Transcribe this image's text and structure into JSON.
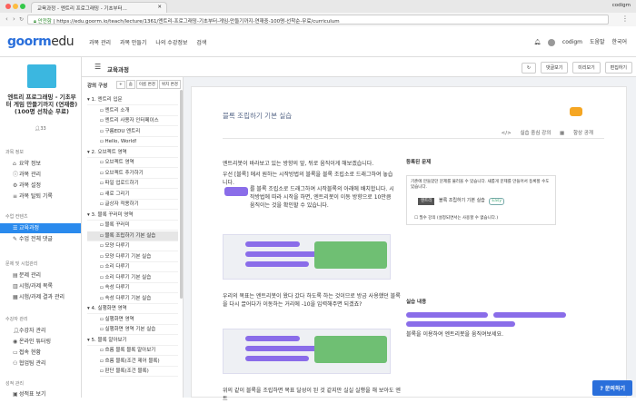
{
  "browser": {
    "tab_title": "교육과정 - 엔트리 프로그래밍 - 기초부터...",
    "profile": "codigm",
    "secure_label": "안전함",
    "url": "https://edu.goorm.io/teach/lecture/1361/엔트리-프로그래밍-기초부터-게임-만들기까지-연재중-100명-선착순-무료/curriculum"
  },
  "header": {
    "logo_main": "goorm",
    "logo_sub": "edu",
    "menu": [
      "과목 관리",
      "과목 만들기",
      "나의 수강정보",
      "검색"
    ],
    "user_name": "codigm",
    "help_label": "도움말",
    "language": "한국어"
  },
  "sidebar": {
    "course_title": "엔트리 프로그래밍 - 기초부터 게임 만들기까지 (연재중)(100명 선착순 무료)",
    "likes": "33",
    "sections": [
      {
        "label": "과목 정보",
        "items": [
          {
            "label": "요약 정보",
            "icon": "home-icon"
          },
          {
            "label": "과목 관리",
            "icon": "info-icon"
          },
          {
            "label": "과목 설정",
            "icon": "gear-icon"
          },
          {
            "label": "과목 탈퇴 기록",
            "icon": "list-icon"
          }
        ]
      },
      {
        "label": "수업 컨텐츠",
        "items": [
          {
            "label": "교육과정",
            "icon": "menu-icon",
            "active": true
          },
          {
            "label": "수업 전체 댓글",
            "icon": "comment-icon"
          }
        ]
      },
      {
        "label": "문제 및 시험관리",
        "items": [
          {
            "label": "문제 관리",
            "icon": "doc-icon"
          },
          {
            "label": "시험/과제 목록",
            "icon": "clipboard-icon"
          },
          {
            "label": "시험/과제 결과 관리",
            "icon": "chart-icon"
          }
        ]
      },
      {
        "label": "수강자 관리",
        "items": [
          {
            "label": "수강자 관리",
            "icon": "user-icon"
          },
          {
            "label": "온라인 튜터링",
            "icon": "tutor-icon"
          },
          {
            "label": "접속 현황",
            "icon": "monitor-icon"
          },
          {
            "label": "협업팀 관리",
            "icon": "team-icon"
          }
        ]
      },
      {
        "label": "성적 관리",
        "items": [
          {
            "label": "성적표 보기",
            "icon": "grade-icon"
          }
        ]
      }
    ]
  },
  "toolbar": {
    "title": "교육과정",
    "buttons": [
      "댓글보기",
      "미리보기",
      "편집하기"
    ]
  },
  "curriculum": {
    "heading": "강의 구성",
    "tools": [
      "+",
      "숨",
      "이름 변경",
      "위치 변경"
    ],
    "items": [
      {
        "label": "1. 엔트리 입문",
        "level": 0
      },
      {
        "label": "엔트리 소개",
        "level": 1
      },
      {
        "label": "엔트리 사용자 인터페이스",
        "level": 1
      },
      {
        "label": "구름EDU 엔트리",
        "level": 1
      },
      {
        "label": "Hello, World!",
        "level": 1
      },
      {
        "label": "2. 오브젝트 영역",
        "level": 0
      },
      {
        "label": "오브젝트 영역",
        "level": 1
      },
      {
        "label": "오브젝트 추가하기",
        "level": 1
      },
      {
        "label": "파일 업로드하기",
        "level": 1
      },
      {
        "label": "새로 그리기",
        "level": 1
      },
      {
        "label": "글상자 적용하기",
        "level": 1
      },
      {
        "label": "3. 블록 꾸러미 영역",
        "level": 0
      },
      {
        "label": "블록 꾸러미",
        "level": 1
      },
      {
        "label": "블록 조립하기 기본 실습",
        "level": 1,
        "selected": true
      },
      {
        "label": "모양 다루기",
        "level": 1
      },
      {
        "label": "모양 다루기 기본 실습",
        "level": 1
      },
      {
        "label": "소리 다루기",
        "level": 1
      },
      {
        "label": "소리 다루기 기본 실습",
        "level": 1
      },
      {
        "label": "속성 다루기",
        "level": 1
      },
      {
        "label": "속성 다루기 기본 실습",
        "level": 1
      },
      {
        "label": "4. 실행화면 영역",
        "level": 0
      },
      {
        "label": "실행화면 영역",
        "level": 1
      },
      {
        "label": "실행화면 영역 기본 실습",
        "level": 1
      },
      {
        "label": "5. 블록 알아보기",
        "level": 0
      },
      {
        "label": "흐름 블록 블록 알아보기",
        "level": 1
      },
      {
        "label": "흐름 블록(조건 제어 블록)",
        "level": 1
      },
      {
        "label": "판단 블록(조건 블록)",
        "level": 1
      }
    ]
  },
  "lesson": {
    "title": "블록 조립하기 기본 실습",
    "meta_type": "실습 중심 강의",
    "meta_public": "항상 공개",
    "para1": "엔트리봇이 바라보고 있는 방향의 앞, 뒤로 움직이게 해보겠습니다.",
    "para2": "우선 [블록] 에서 원하는 시작방법의 블록을 블록 조립소로 드래그하여 놓습니다.",
    "para3": "를 블록 조립소로 드래그하여 시작블록의 아래에 배치합니다. 시작방법에 따라 시작을 하면, 엔트리봇이 이동 방향으로 10만큼 움직이는 것을 확인할 수 있습니다.",
    "para4": "우리의 목표는 엔트리봇이 왔다 갔다 하도록 하는 것이므로 방금 사용했던 블록을 다시 끌어다가 이동하는 거리에 -10을 입력해주면 되겠죠?",
    "para5": "위의 같이 블록을 조립하면 목표 달성이 된 것 같지만 실실 실행을 해 보아도 엔트",
    "block_label": "이동 방향으로 10 만큼 움직이기",
    "problem_heading": "등록된 문제",
    "problem_desc": "기존에 만들었던 문제를 불러올 수 있습니다. 새롭게 문제를 만들어서 등록할 수도 있습니다.",
    "problem_tag": "엔트리",
    "problem_name": "블록 조립하기 기본 실습",
    "problem_level": "Easy",
    "problem_check": "필수 강의 (설정되면서는 사용할 수 없습니다.)",
    "practice_heading": "실습 내용",
    "practice_text": "블록을 이용하여 엔트리봇을 움직여보세요."
  },
  "help_button": "문의하기"
}
